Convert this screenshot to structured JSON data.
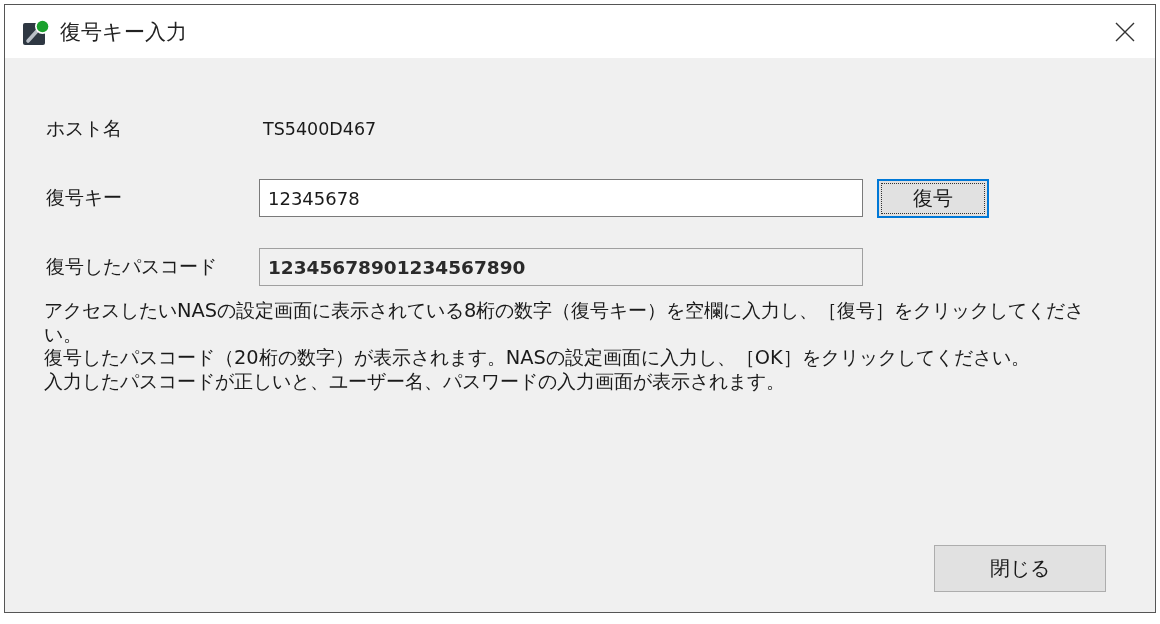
{
  "window": {
    "title": "復号キー入力"
  },
  "fields": [
    {
      "kind": "text",
      "label": "ホスト名",
      "value": "TS5400D467"
    },
    {
      "kind": "input",
      "label": "復号キー",
      "value": "12345678",
      "button": {
        "label": "復号",
        "focused": true
      }
    },
    {
      "kind": "readonly",
      "label": "復号したパスコード",
      "value": "12345678901234567890"
    }
  ],
  "instructions": [
    "アクセスしたいNASの設定画面に表示されている8桁の数字（復号キー）を空欄に入力し、［復号］をクリックしてください。",
    "復号したパスコード（20桁の数字）が表示されます。NASの設定画面に入力し、［OK］をクリックしてください。",
    "入力したパスコードが正しいと、ユーザー名、パスワードの入力画面が表示されます。"
  ],
  "buttons": [
    {
      "label": "閉じる"
    }
  ]
}
